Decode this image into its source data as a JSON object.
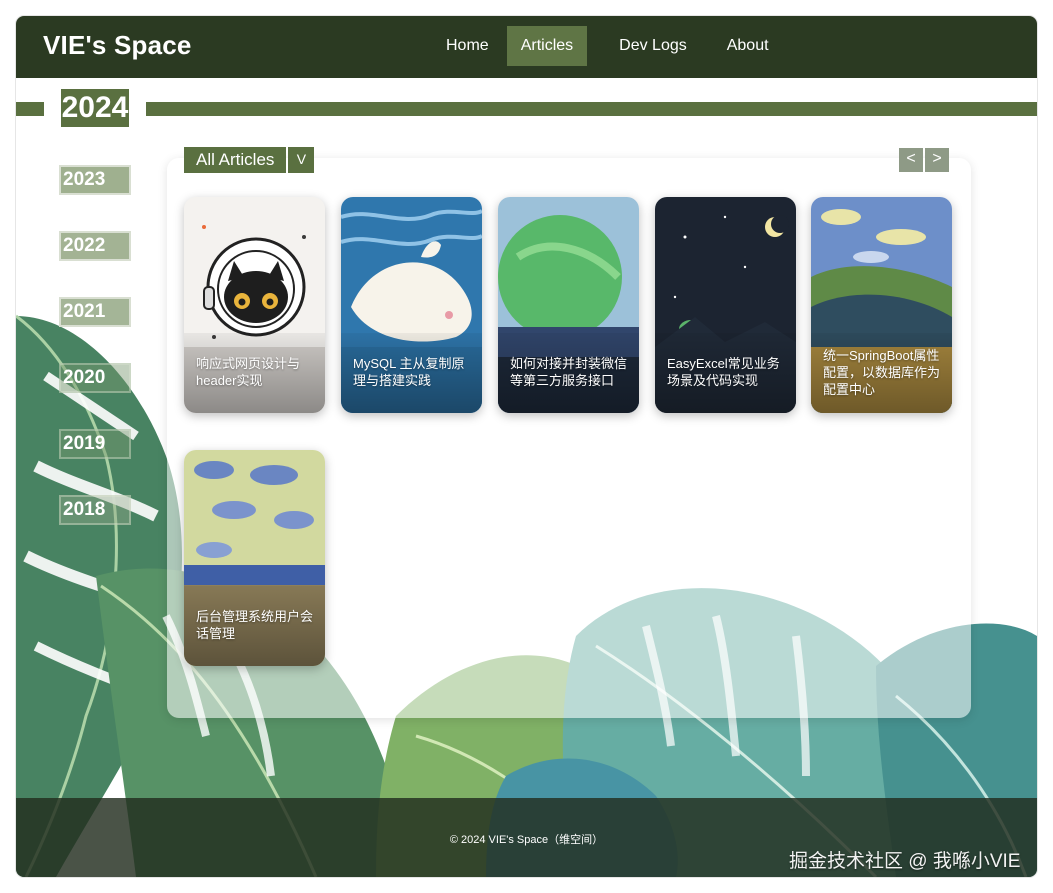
{
  "header": {
    "brand": "VIE's Space",
    "nav": [
      "Home",
      "Articles",
      "Dev Logs",
      "About"
    ],
    "active_nav": "Articles"
  },
  "timeline": {
    "current_year": "2024",
    "years": [
      "2023",
      "2022",
      "2021",
      "2020",
      "2019",
      "2018"
    ]
  },
  "filter": {
    "label": "All Articles",
    "toggle": "V"
  },
  "pager": {
    "prev": "<",
    "next": ">"
  },
  "articles": [
    "响应式网页设计与header实现",
    "MySQL 主从复制原理与搭建实践",
    "如何对接并封装微信等第三方服务接口",
    "EasyExcel常见业务场景及代码实现",
    "统一SpringBoot属性配置，以数据库作为配置中心",
    "后台管理系统用户会话管理"
  ],
  "footer": {
    "copyright": "© 2024 VIE's Space（维空间）",
    "watermark": "掘金技术社区 @ 我喺小VIE"
  },
  "colors": {
    "header_bg": "#2b3a22",
    "accent": "#5a7040",
    "nav_active": "#5f7545"
  }
}
